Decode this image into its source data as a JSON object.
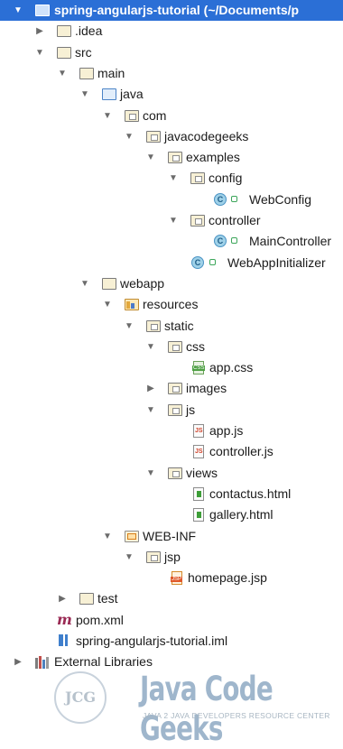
{
  "project": {
    "root_label": "spring-angularjs-tutorial (~/Documents/p",
    "idea": ".idea",
    "src": "src",
    "main": "main",
    "java": "java",
    "com": "com",
    "javacodegeeks": "javacodegeeks",
    "examples": "examples",
    "config": "config",
    "webconfig": "WebConfig",
    "controller": "controller",
    "maincontroller": "MainController",
    "webappinitializer": "WebAppInitializer",
    "webapp": "webapp",
    "resources": "resources",
    "static": "static",
    "css": "css",
    "app_css": "app.css",
    "images": "images",
    "js": "js",
    "app_js": "app.js",
    "controller_js": "controller.js",
    "views": "views",
    "contactus_html": "contactus.html",
    "gallery_html": "gallery.html",
    "web_inf": "WEB-INF",
    "jsp": "jsp",
    "homepage_jsp": "homepage.jsp",
    "test": "test",
    "pom_xml": "pom.xml",
    "iml": "spring-angularjs-tutorial.iml",
    "external_libraries": "External Libraries"
  },
  "icons": {
    "expanded": "▼",
    "collapsed": "▶",
    "class_letter": "C"
  },
  "watermark": {
    "logo": "JCG",
    "title": "Java Code Geeks",
    "subtitle": "JAVA 2 JAVA DEVELOPERS RESOURCE CENTER"
  },
  "colors": {
    "selection": "#2b6fd6",
    "watermark": "#9fb6cc"
  }
}
